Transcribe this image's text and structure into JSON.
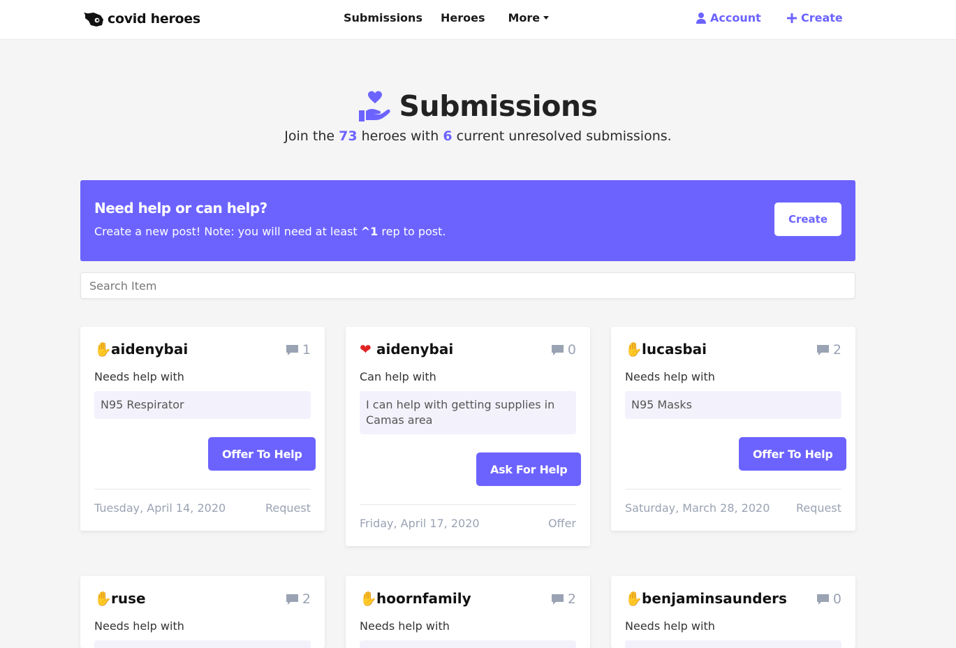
{
  "nav": {
    "brand": "covid heroes",
    "links": [
      "Submissions",
      "Heroes",
      "More"
    ],
    "account": "Account",
    "create": "Create"
  },
  "header": {
    "title": "Submissions",
    "sub_prefix": "Join the",
    "heroes_count": "73",
    "sub_mid": "heroes with",
    "submissions_count": "6",
    "sub_suffix": "current unresolved submissions."
  },
  "cta": {
    "title": "Need help or can help?",
    "text_prefix": "Create a new post! Note: you will need at least",
    "rep_arrow": "^",
    "rep_value": "1",
    "text_suffix": "rep to post.",
    "button": "Create"
  },
  "search": {
    "placeholder": "Search Item"
  },
  "cards": [
    {
      "emoji": "✋",
      "user": "aidenybai",
      "comments": "1",
      "label": "Needs help with",
      "item": "N95 Respirator",
      "button": "Offer To Help",
      "date": "Tuesday, April 14, 2020",
      "type": "Request"
    },
    {
      "emoji": "❤",
      "user": "aidenybai",
      "comments": "0",
      "label": "Can help with",
      "item": "I can help with getting supplies in Camas area",
      "button": "Ask For Help",
      "date": "Friday, April 17, 2020",
      "type": "Offer"
    },
    {
      "emoji": "✋",
      "user": "lucasbai",
      "comments": "2",
      "label": "Needs help with",
      "item": "N95 Masks",
      "button": "Offer To Help",
      "date": "Saturday, March 28, 2020",
      "type": "Request"
    },
    {
      "emoji": "✋",
      "user": "ruse",
      "comments": "2",
      "label": "Needs help with"
    },
    {
      "emoji": "✋",
      "user": "hoornfamily",
      "comments": "2",
      "label": "Needs help with"
    },
    {
      "emoji": "✋",
      "user": "benjaminsaunders",
      "comments": "0",
      "label": "Needs help with"
    }
  ],
  "colors": {
    "accent": "#6c63ff",
    "muted": "#9aa3b3",
    "background": "#f5f5f5",
    "heart": "#e02424",
    "hand": "#f5b93b"
  }
}
